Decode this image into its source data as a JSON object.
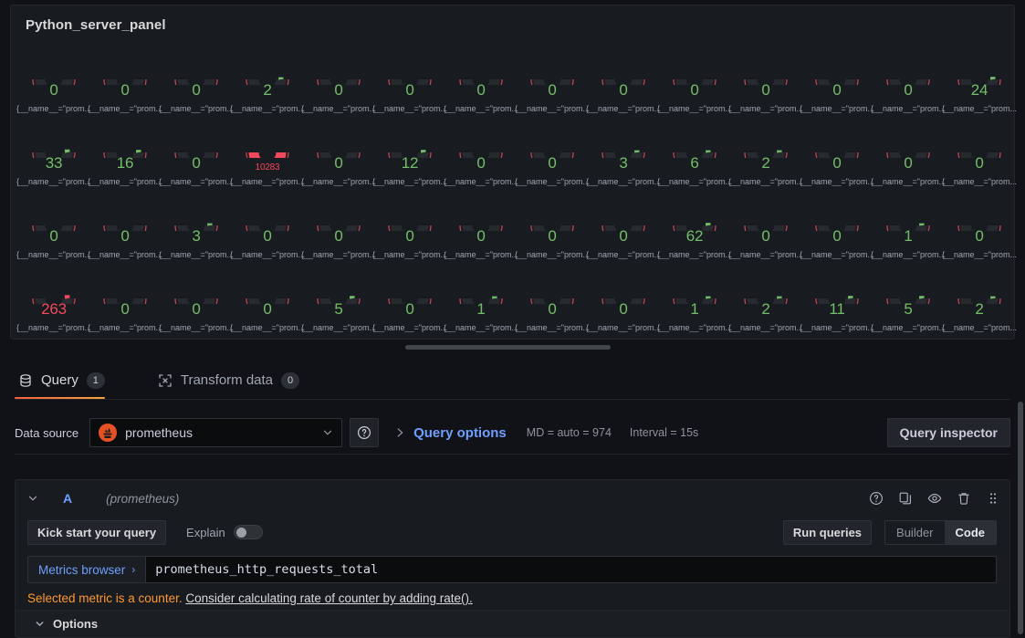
{
  "panel": {
    "title": "Python_server_panel",
    "gauge_label": "{__name__=\"prom...",
    "colors": {
      "ok": "#73bf69",
      "critical": "#f2495c",
      "track": "#2a2d32",
      "threshold_arc": "#c24551"
    },
    "gauges": [
      {
        "value": "0",
        "state": "ok",
        "fill": 0
      },
      {
        "value": "0",
        "state": "ok",
        "fill": 0
      },
      {
        "value": "0",
        "state": "ok",
        "fill": 0
      },
      {
        "value": "2",
        "state": "ok",
        "fill": 5
      },
      {
        "value": "0",
        "state": "ok",
        "fill": 0
      },
      {
        "value": "0",
        "state": "ok",
        "fill": 0
      },
      {
        "value": "0",
        "state": "ok",
        "fill": 0
      },
      {
        "value": "0",
        "state": "ok",
        "fill": 0
      },
      {
        "value": "0",
        "state": "ok",
        "fill": 0
      },
      {
        "value": "0",
        "state": "ok",
        "fill": 0
      },
      {
        "value": "0",
        "state": "ok",
        "fill": 0
      },
      {
        "value": "0",
        "state": "ok",
        "fill": 0
      },
      {
        "value": "0",
        "state": "ok",
        "fill": 0
      },
      {
        "value": "24",
        "state": "ok",
        "fill": 6
      },
      {
        "value": "33",
        "state": "ok",
        "fill": 7
      },
      {
        "value": "16",
        "state": "ok",
        "fill": 6
      },
      {
        "value": "0",
        "state": "ok",
        "fill": 0
      },
      {
        "value": "10283",
        "state": "critical",
        "fill": 100
      },
      {
        "value": "0",
        "state": "ok",
        "fill": 0
      },
      {
        "value": "12",
        "state": "ok",
        "fill": 6
      },
      {
        "value": "0",
        "state": "ok",
        "fill": 0
      },
      {
        "value": "0",
        "state": "ok",
        "fill": 0
      },
      {
        "value": "3",
        "state": "ok",
        "fill": 5
      },
      {
        "value": "6",
        "state": "ok",
        "fill": 5
      },
      {
        "value": "2",
        "state": "ok",
        "fill": 5
      },
      {
        "value": "0",
        "state": "ok",
        "fill": 0
      },
      {
        "value": "0",
        "state": "ok",
        "fill": 0
      },
      {
        "value": "0",
        "state": "ok",
        "fill": 0
      },
      {
        "value": "0",
        "state": "ok",
        "fill": 0
      },
      {
        "value": "0",
        "state": "ok",
        "fill": 0
      },
      {
        "value": "3",
        "state": "ok",
        "fill": 5
      },
      {
        "value": "0",
        "state": "ok",
        "fill": 0
      },
      {
        "value": "0",
        "state": "ok",
        "fill": 0
      },
      {
        "value": "0",
        "state": "ok",
        "fill": 0
      },
      {
        "value": "0",
        "state": "ok",
        "fill": 0
      },
      {
        "value": "0",
        "state": "ok",
        "fill": 0
      },
      {
        "value": "0",
        "state": "ok",
        "fill": 0
      },
      {
        "value": "62",
        "state": "ok",
        "fill": 6
      },
      {
        "value": "0",
        "state": "ok",
        "fill": 0
      },
      {
        "value": "0",
        "state": "ok",
        "fill": 0
      },
      {
        "value": "1",
        "state": "ok",
        "fill": 5
      },
      {
        "value": "0",
        "state": "ok",
        "fill": 0
      },
      {
        "value": "263",
        "state": "critical_small",
        "fill": 8
      },
      {
        "value": "0",
        "state": "ok",
        "fill": 0
      },
      {
        "value": "0",
        "state": "ok",
        "fill": 0
      },
      {
        "value": "0",
        "state": "ok",
        "fill": 0
      },
      {
        "value": "5",
        "state": "ok",
        "fill": 6
      },
      {
        "value": "0",
        "state": "ok",
        "fill": 0
      },
      {
        "value": "1",
        "state": "ok",
        "fill": 5
      },
      {
        "value": "0",
        "state": "ok",
        "fill": 0
      },
      {
        "value": "0",
        "state": "ok",
        "fill": 0
      },
      {
        "value": "1",
        "state": "ok",
        "fill": 5
      },
      {
        "value": "2",
        "state": "ok",
        "fill": 5
      },
      {
        "value": "11",
        "state": "ok",
        "fill": 6
      },
      {
        "value": "5",
        "state": "ok",
        "fill": 6
      },
      {
        "value": "2",
        "state": "ok",
        "fill": 5
      }
    ]
  },
  "tabs": [
    {
      "label": "Query",
      "badge": "1",
      "icon": "database-icon",
      "active": true
    },
    {
      "label": "Transform data",
      "badge": "0",
      "icon": "transform-icon",
      "active": false
    }
  ],
  "datasource_row": {
    "label": "Data source",
    "selected": "prometheus",
    "logo": "prometheus-logo",
    "help_icon": "help-circle-icon",
    "query_options_label": "Query options",
    "max_data_points": "MD = auto = 974",
    "interval": "Interval = 15s",
    "query_inspector": "Query inspector"
  },
  "query": {
    "ref_id": "A",
    "datasource_note": "(prometheus)",
    "actions": [
      "help-circle-icon",
      "duplicate-icon",
      "eye-icon",
      "trash-icon",
      "drag-handle-icon"
    ],
    "kick_start": "Kick start your query",
    "explain_label": "Explain",
    "explain_on": false,
    "run_queries": "Run queries",
    "mode_builder": "Builder",
    "mode_code": "Code",
    "mode_selected": "Code",
    "metrics_browser": "Metrics browser",
    "metrics_browser_chevron": "›",
    "expression": "prometheus_http_requests_total",
    "warning_text": "Selected metric is a counter.",
    "warning_link": "Consider calculating rate of counter by adding rate().",
    "options_label": "Options"
  }
}
